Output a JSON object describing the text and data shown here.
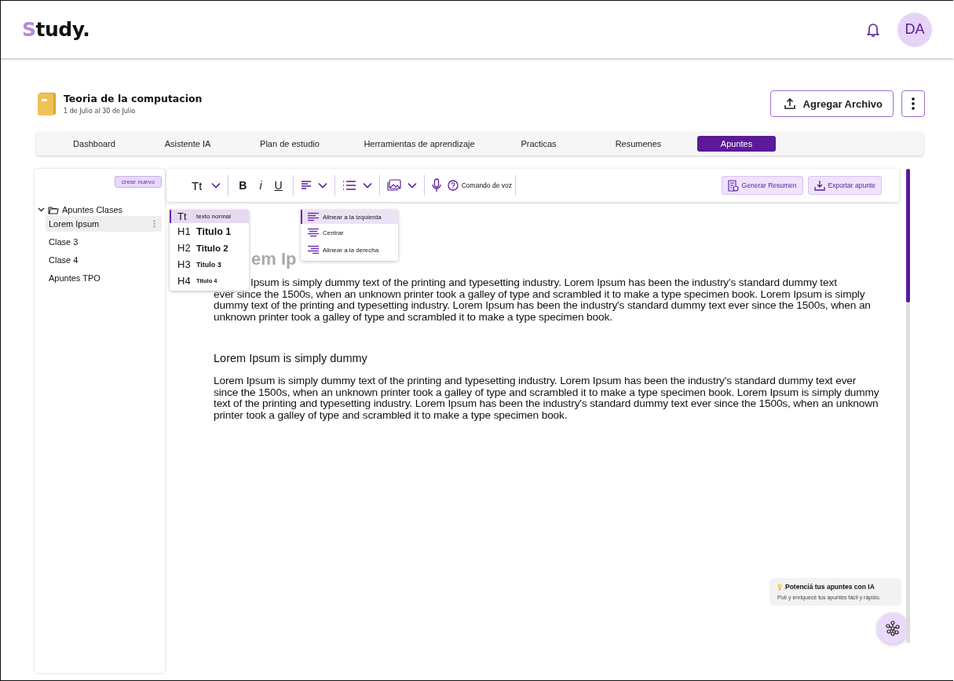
{
  "header": {
    "logo_accent": "S",
    "logo_rest": "tudy.",
    "avatar": "DA"
  },
  "course": {
    "title": "Teoria de la computacion",
    "dates": "1 de Julio al 30 de Julio",
    "upload_button": "Agregar Archivo"
  },
  "tabs": [
    {
      "label": "Dashboard",
      "selected": false
    },
    {
      "label": "Asistente IA",
      "selected": false
    },
    {
      "label": "Plan de estudio",
      "selected": false
    },
    {
      "label": "Herramientas de aprendizaje",
      "selected": false
    },
    {
      "label": "Practicas",
      "selected": false
    },
    {
      "label": "Resumenes",
      "selected": false
    },
    {
      "label": "Apuntes",
      "selected": true
    }
  ],
  "sidebar": {
    "new_button": "crear nuevo",
    "folders": [
      {
        "label": "Apuntes Clases",
        "expanded": true,
        "children": [
          {
            "label": "Lorem Ipsum",
            "selected": true
          },
          {
            "label": "Clase 3",
            "selected": false
          },
          {
            "label": "Clase 4",
            "selected": false
          },
          {
            "label": "Apuntes TPO",
            "selected": false
          }
        ]
      }
    ]
  },
  "toolbar": {
    "text_style": "Tt",
    "bold": "B",
    "italic": "i",
    "underline": "U",
    "voice": "Comando de voz",
    "summary_button": "Generar Resumen",
    "export_button": "Exportar apunte"
  },
  "text_menu": [
    {
      "kind": "normal",
      "tag": "Tt",
      "label": "texto normal",
      "selected": true
    },
    {
      "kind": "h1",
      "tag": "H1",
      "label": "Titulo 1",
      "selected": false
    },
    {
      "kind": "h2",
      "tag": "H2",
      "label": "Titulo 2",
      "selected": false
    },
    {
      "kind": "h3",
      "tag": "H3",
      "label": "Titulo 3",
      "selected": false
    },
    {
      "kind": "h4",
      "tag": "H4",
      "label": "Titulo 4",
      "selected": false
    }
  ],
  "align_menu": [
    {
      "kind": "left",
      "label": "Alinear a la izquierda",
      "selected": true
    },
    {
      "kind": "center",
      "label": "Centrar",
      "selected": false
    },
    {
      "kind": "right",
      "label": "Alinear a la derecha",
      "selected": false
    }
  ],
  "document": {
    "blocks": [
      {
        "kind": "title",
        "text": "em Ip"
      },
      {
        "kind": "line",
        "text": "Ipsum is simply dummy text of the printing and typesetting industry. Lorem Ipsum has been the industry's standard dummy text"
      },
      {
        "kind": "continued",
        "text": "ever since the 1500s, when an unknown printer took a galley of type and scrambled it to make a type specimen book. Lorem Ipsum is simply dummy text of the printing and typesetting industry. Lorem Ipsum has been the industry's standard dummy text ever since the 1500s, when an unknown printer took a galley of type and scrambled it to make a type specimen book."
      },
      {
        "kind": "subtitle",
        "text": "Lorem Ipsum is simply dummy"
      },
      {
        "kind": "para",
        "text": "Lorem Ipsum is simply dummy text of the printing and typesetting industry. Lorem Ipsum has been the industry's standard dummy text ever since the 1500s, when an unknown printer took a galley of type and scrambled it to make a type specimen book. Lorem Ipsum is simply dummy text of the printing and typesetting industry. Lorem Ipsum has been the industry's standard dummy text ever since the 1500s, when an unknown printer took a galley of type and scrambled it to make a type specimen book."
      }
    ]
  },
  "ai_card": {
    "title": "Potenciá tus apuntes con IA",
    "text": "Pulí y enriquecé tus apuntes fácil y rápido."
  }
}
